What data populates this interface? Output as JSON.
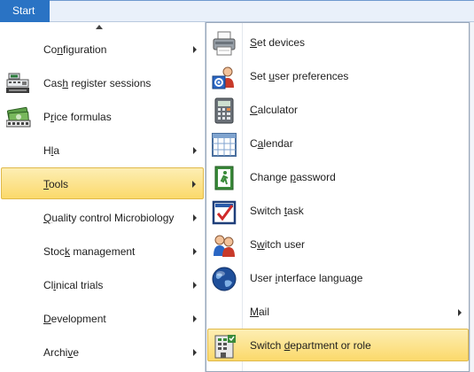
{
  "topbar": {
    "start_label": "Start"
  },
  "left_menu": {
    "items": [
      {
        "pre": "Co",
        "acc": "n",
        "post": "figuration",
        "icon": "",
        "submenu": true
      },
      {
        "pre": "Cas",
        "acc": "h",
        "post": " register sessions",
        "icon": "cash-register-icon",
        "submenu": false
      },
      {
        "pre": "P",
        "acc": "r",
        "post": "ice formulas",
        "icon": "money-icon",
        "submenu": false
      },
      {
        "pre": "H",
        "acc": "l",
        "post": "a",
        "icon": "",
        "submenu": true
      },
      {
        "pre": "",
        "acc": "T",
        "post": "ools",
        "icon": "",
        "submenu": true,
        "selected": true
      },
      {
        "pre": "",
        "acc": "Q",
        "post": "uality control Microbiology",
        "icon": "",
        "submenu": true
      },
      {
        "pre": "Stoc",
        "acc": "k",
        "post": " management",
        "icon": "",
        "submenu": true
      },
      {
        "pre": "Cl",
        "acc": "i",
        "post": "nical trials",
        "icon": "",
        "submenu": true
      },
      {
        "pre": "",
        "acc": "D",
        "post": "evelopment",
        "icon": "",
        "submenu": true
      },
      {
        "pre": "Archi",
        "acc": "v",
        "post": "e",
        "icon": "",
        "submenu": true
      }
    ]
  },
  "right_menu": {
    "items": [
      {
        "pre": "",
        "acc": "S",
        "post": "et devices",
        "icon": "printer-icon",
        "submenu": false
      },
      {
        "pre": "Set ",
        "acc": "u",
        "post": "ser preferences",
        "icon": "user-settings-icon",
        "submenu": false
      },
      {
        "pre": "",
        "acc": "C",
        "post": "alculator",
        "icon": "calculator-icon",
        "submenu": false
      },
      {
        "pre": "C",
        "acc": "a",
        "post": "lendar",
        "icon": "calendar-icon",
        "submenu": false
      },
      {
        "pre": "Change ",
        "acc": "p",
        "post": "assword",
        "icon": "exit-door-icon",
        "submenu": false
      },
      {
        "pre": "Switch ",
        "acc": "t",
        "post": "ask",
        "icon": "task-check-icon",
        "submenu": false
      },
      {
        "pre": "S",
        "acc": "w",
        "post": "itch user",
        "icon": "users-icon",
        "submenu": false
      },
      {
        "pre": "User ",
        "acc": "i",
        "post": "nterface language",
        "icon": "globe-icon",
        "submenu": false
      },
      {
        "pre": "",
        "acc": "M",
        "post": "ail",
        "icon": "",
        "submenu": true
      },
      {
        "pre": "Switch ",
        "acc": "d",
        "post": "epartment or role",
        "icon": "department-icon",
        "submenu": false,
        "selected": true
      }
    ]
  }
}
